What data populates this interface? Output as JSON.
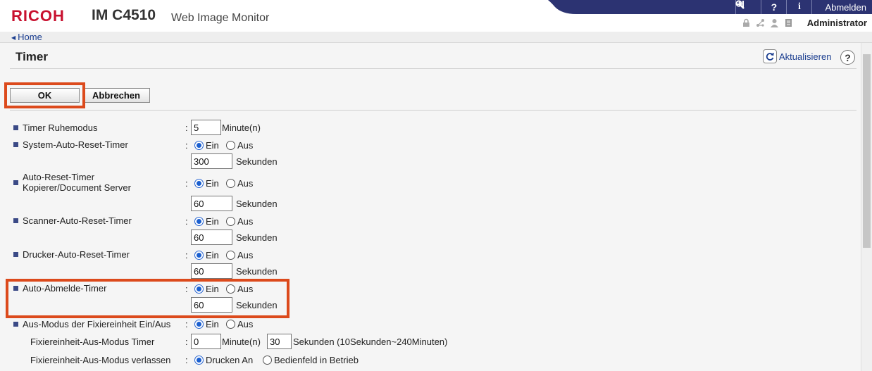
{
  "header": {
    "brand": "RICOH",
    "model": "IM C4510",
    "app_name": "Web Image Monitor",
    "logout_label": "Abmelden",
    "user": "Administrator",
    "icons": [
      "search-icon",
      "help-icon",
      "info-icon",
      "logout-icon",
      "lock-icon",
      "network-icon",
      "user-icon",
      "document-icon"
    ]
  },
  "breadcrumb": {
    "home": "Home"
  },
  "page": {
    "title": "Timer",
    "refresh_label": "Aktualisieren",
    "help_label": "?"
  },
  "buttons": {
    "ok": "OK",
    "cancel": "Abbrechen"
  },
  "common": {
    "on": "Ein",
    "off": "Aus",
    "seconds": "Sekunden",
    "colon": ":"
  },
  "settings": {
    "sleep_timer": {
      "label": "Timer Ruhemodus",
      "value": "5",
      "unit": "Minute(n)"
    },
    "system_reset": {
      "label": "System-Auto-Reset-Timer",
      "state": "Ein",
      "value": "300"
    },
    "copier_reset": {
      "label_line1": "Auto-Reset-Timer",
      "label_line2": "Kopierer/Document Server",
      "state": "Ein",
      "value": "60"
    },
    "scanner_reset": {
      "label": "Scanner-Auto-Reset-Timer",
      "state": "Ein",
      "value": "60"
    },
    "printer_reset": {
      "label": "Drucker-Auto-Reset-Timer",
      "state": "Ein",
      "value": "60"
    },
    "auto_logout": {
      "label": "Auto-Abmelde-Timer",
      "state": "Ein",
      "value": "60"
    },
    "fuser_off": {
      "label": "Aus-Modus der Fixiereinheit Ein/Aus",
      "state": "Ein",
      "timer_label": "Fixiereinheit-Aus-Modus Timer",
      "minutes": "0",
      "minutes_unit": "Minute(n)",
      "seconds": "30",
      "seconds_unit": "Sekunden (10Sekunden~240Minuten)",
      "exit_label": "Fixiereinheit-Aus-Modus verlassen",
      "exit_options": [
        "Drucken An",
        "Bedienfeld in Betrieb"
      ],
      "exit_selected": "Drucken An"
    }
  },
  "colors": {
    "brand_red": "#c8102e",
    "header_navy": "#2c3372",
    "highlight": "#dc4a1c",
    "link": "#1a3d8f"
  }
}
